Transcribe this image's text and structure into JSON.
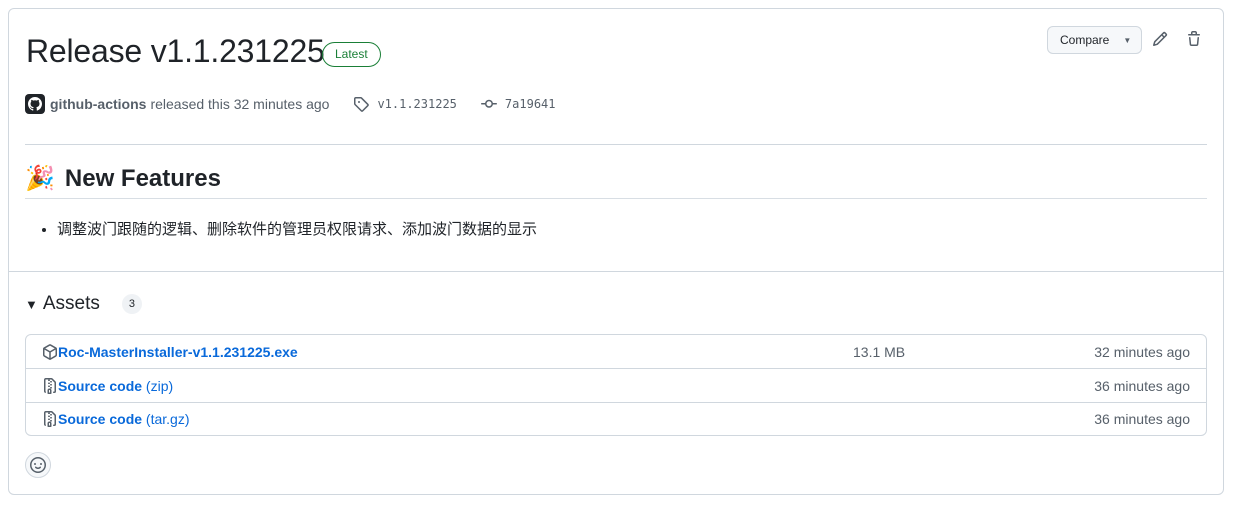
{
  "release": {
    "title": "Release v1.1.231225",
    "latest_label": "Latest",
    "compare_label": "Compare",
    "author": "github-actions",
    "released_text": "released this 32 minutes ago",
    "tag": "v1.1.231225",
    "commit": "7a19641"
  },
  "notes": {
    "heading_emoji": "🎉",
    "heading": "New Features",
    "items": [
      "调整波门跟随的逻辑、删除软件的管理员权限请求、添加波门数据的显示"
    ]
  },
  "assets": {
    "title": "Assets",
    "count": "3",
    "items": [
      {
        "name": "Roc-MasterInstaller-v1.1.231225.exe",
        "ext": "",
        "size": "13.1 MB",
        "time": "32 minutes ago",
        "icon": "package-icon"
      },
      {
        "name": "Source code",
        "ext": "(zip)",
        "size": "",
        "time": "36 minutes ago",
        "icon": "file-zip-icon"
      },
      {
        "name": "Source code",
        "ext": "(tar.gz)",
        "size": "",
        "time": "36 minutes ago",
        "icon": "file-zip-icon"
      }
    ]
  },
  "colors": {
    "link": "#0969da",
    "latest": "#1a7f37",
    "border": "#d0d7de",
    "muted": "#57606a"
  }
}
